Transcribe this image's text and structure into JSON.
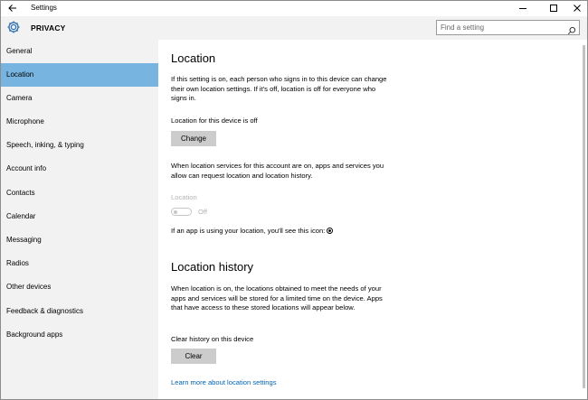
{
  "window": {
    "title": "Settings",
    "controls": {
      "minimize": "minimize",
      "maximize": "maximize",
      "close": "close"
    }
  },
  "header": {
    "title": "PRIVACY",
    "search_placeholder": "Find a setting"
  },
  "sidebar": {
    "selected": "Location",
    "items": [
      {
        "label": "General"
      },
      {
        "label": "Location"
      },
      {
        "label": "Camera"
      },
      {
        "label": "Microphone"
      },
      {
        "label": "Speech, inking, & typing"
      },
      {
        "label": "Account info"
      },
      {
        "label": "Contacts"
      },
      {
        "label": "Calendar"
      },
      {
        "label": "Messaging"
      },
      {
        "label": "Radios"
      },
      {
        "label": "Other devices"
      },
      {
        "label": "Feedback & diagnostics"
      },
      {
        "label": "Background apps"
      }
    ]
  },
  "main": {
    "location": {
      "heading": "Location",
      "description": "If this setting is on, each person who signs in to this device can change their own location settings. If it's off, location is off for everyone who signs in.",
      "device_status": "Location for this device is off",
      "change_button": "Change",
      "services_description": "When location services for this account are on, apps and services you allow can request location and location history.",
      "toggle_label": "Location",
      "toggle_state": "Off",
      "icon_note": "If an app is using your location, you'll see this icon:"
    },
    "history": {
      "heading": "Location history",
      "description": "When location is on, the locations obtained to meet the needs of your apps and services will be stored for a limited time on the device. Apps that have access to these stored locations will appear below.",
      "clear_label": "Clear history on this device",
      "clear_button": "Clear"
    },
    "learn_more_link": "Learn more about location settings"
  },
  "colors": {
    "accent_selected": "#77b5e0",
    "sidebar_bg": "#f2f2f2",
    "link": "#0063b1",
    "button_bg": "#cccccc"
  },
  "icons": [
    "back-arrow-icon",
    "gear-icon",
    "search-icon",
    "location-indicator-icon"
  ]
}
